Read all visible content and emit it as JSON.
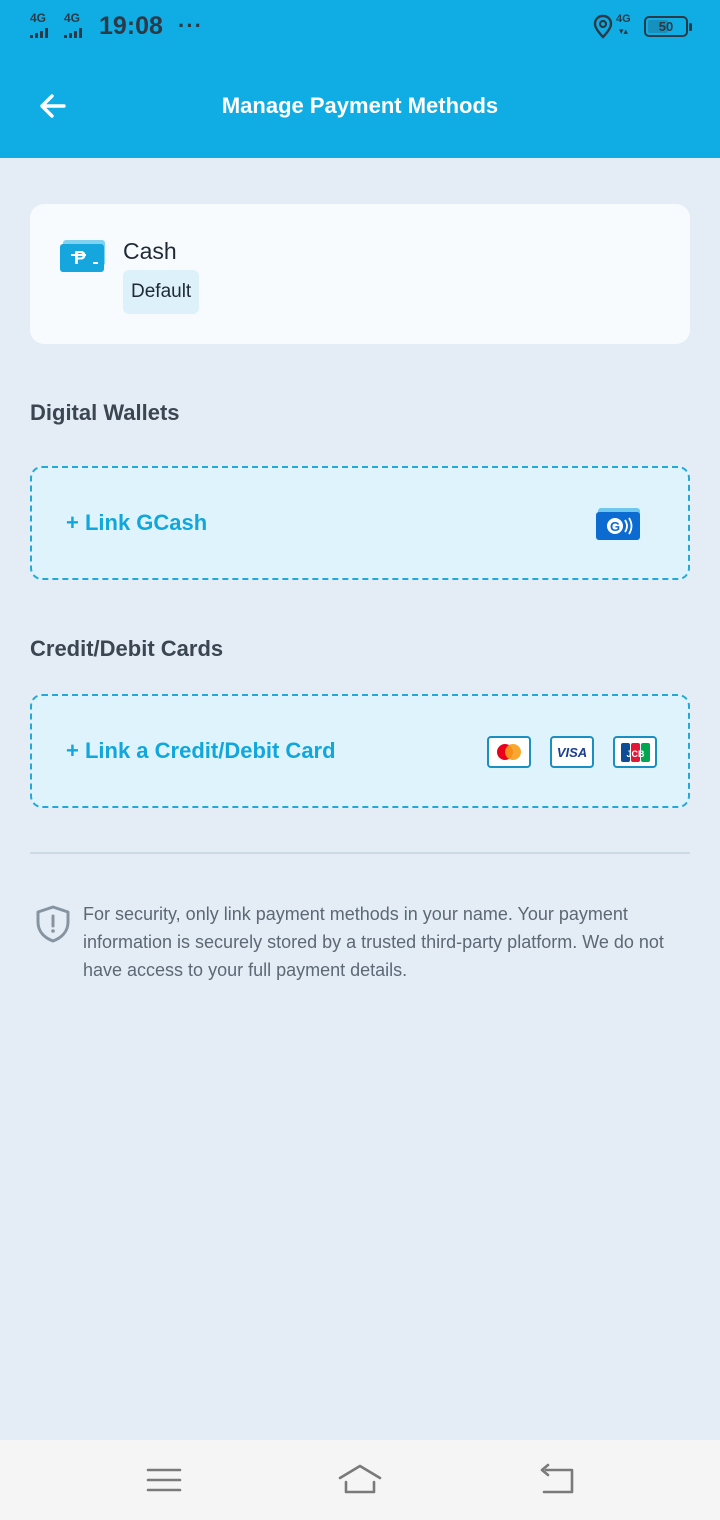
{
  "status_bar": {
    "signal_1": "4G",
    "signal_2": "4G",
    "time": "19:08",
    "more": "···",
    "network": "4G",
    "battery": "50",
    "icons": [
      "signal-icon",
      "location-icon",
      "battery-icon"
    ]
  },
  "header": {
    "title": "Manage Payment Methods",
    "back_icon": "arrow-left-icon",
    "background": "#0fade3"
  },
  "cash": {
    "label": "Cash",
    "badge": "Default",
    "icon": "cash-peso-icon"
  },
  "digital_wallets": {
    "title": "Digital Wallets",
    "link_label": "+ Link GCash",
    "icon": "gcash-icon"
  },
  "cards": {
    "title": "Credit/Debit Cards",
    "link_label": "+ Link a Credit/Debit Card",
    "icons": [
      "mastercard-icon",
      "visa-icon",
      "jcb-icon"
    ],
    "visa_text": "VISA",
    "jcb_text": "JCB"
  },
  "security": {
    "icon": "shield-icon",
    "text": "For security, only link payment methods in your name. Your payment information is securely stored by a trusted third-party platform. We do not have access to your full payment details."
  },
  "nav": {
    "icons": [
      "menu-icon",
      "home-icon",
      "back-icon"
    ]
  },
  "colors": {
    "accent": "#12a7dc",
    "page_bg": "#e4edf6"
  }
}
